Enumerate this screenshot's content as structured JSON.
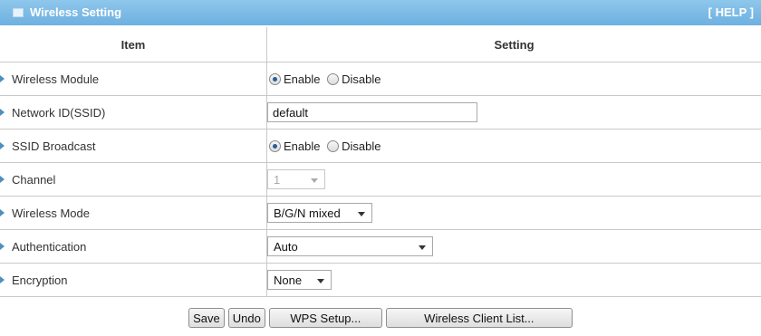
{
  "header": {
    "title": "Wireless Setting",
    "help": "[ HELP ]"
  },
  "table": {
    "col_item": "Item",
    "col_setting": "Setting",
    "rows": {
      "wireless_module": {
        "label": "Wireless Module",
        "options": [
          "Enable",
          "Disable"
        ],
        "selected": "Enable"
      },
      "network_id": {
        "label": "Network ID(SSID)",
        "value": "default"
      },
      "ssid_broadcast": {
        "label": "SSID Broadcast",
        "options": [
          "Enable",
          "Disable"
        ],
        "selected": "Enable"
      },
      "channel": {
        "label": "Channel",
        "value": "1",
        "disabled": true
      },
      "wireless_mode": {
        "label": "Wireless Mode",
        "value": "B/G/N mixed"
      },
      "authentication": {
        "label": "Authentication",
        "value": "Auto"
      },
      "encryption": {
        "label": "Encryption",
        "value": "None"
      }
    }
  },
  "buttons": {
    "save": "Save",
    "undo": "Undo",
    "wps_setup": "WPS Setup...",
    "client_list": "Wireless Client List..."
  },
  "colors": {
    "header_bg": "#7dbde8",
    "border": "#c9c9c9",
    "arrow": "#4d8fbf"
  },
  "icons": {
    "header": "window-icon",
    "row": "triangle-right-icon",
    "select": "chevron-down-icon"
  }
}
